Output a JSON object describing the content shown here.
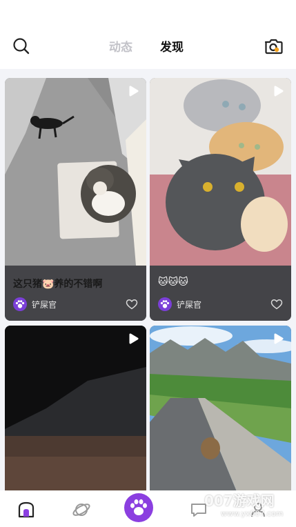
{
  "header": {
    "tabs": [
      {
        "label": "动态",
        "active": false
      },
      {
        "label": "发现",
        "active": true
      }
    ],
    "icons": {
      "search": "search-icon",
      "camera": "camera-icon"
    }
  },
  "feed": {
    "cards": [
      {
        "title": "这只猪🐷养的不错啊",
        "author": "铲屎官",
        "media": "video",
        "liked": false
      },
      {
        "title": "🐱🐱🐱",
        "author": "铲屎官",
        "media": "video",
        "liked": false
      },
      {
        "title": "",
        "author": "",
        "media": "video",
        "liked": false
      },
      {
        "title": "",
        "author": "",
        "media": "video",
        "liked": false
      }
    ]
  },
  "bottom_nav": {
    "items": [
      {
        "name": "home",
        "icon": "home-icon"
      },
      {
        "name": "discover",
        "icon": "planet-icon"
      },
      {
        "name": "center",
        "icon": "paw-icon"
      },
      {
        "name": "message",
        "icon": "message-icon"
      },
      {
        "name": "profile",
        "icon": "profile-icon"
      }
    ],
    "accent": "#8b3fe0"
  },
  "watermark": {
    "text": "007游戏网",
    "url": "www.yx007.com"
  }
}
